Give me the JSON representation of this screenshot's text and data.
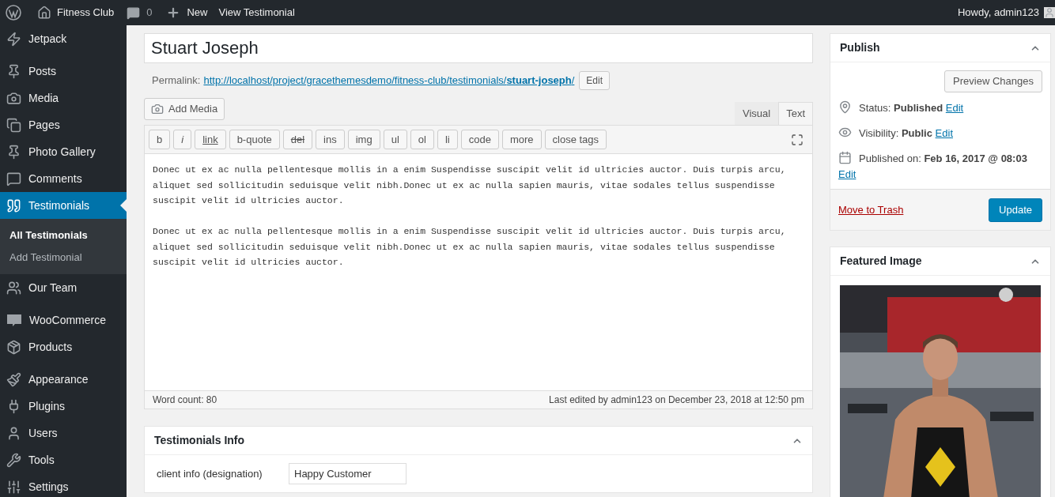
{
  "admin_bar": {
    "site_name": "Fitness Club",
    "comments_count": "0",
    "new_label": "New",
    "view_label": "View Testimonial",
    "greeting": "Howdy, admin123"
  },
  "sidebar": {
    "groups": [
      [
        {
          "label": "Jetpack",
          "selected": false
        }
      ],
      [
        {
          "label": "Posts",
          "selected": false
        },
        {
          "label": "Media",
          "selected": false
        },
        {
          "label": "Pages",
          "selected": false
        },
        {
          "label": "Photo Gallery",
          "selected": false
        },
        {
          "label": "Comments",
          "selected": false
        },
        {
          "label": "Testimonials",
          "selected": true,
          "children": [
            {
              "label": "All Testimonials",
              "selected": true
            },
            {
              "label": "Add Testimonial",
              "selected": false
            }
          ]
        },
        {
          "label": "Our Team",
          "selected": false
        }
      ],
      [
        {
          "label": "WooCommerce",
          "selected": false
        },
        {
          "label": "Products",
          "selected": false
        }
      ],
      [
        {
          "label": "Appearance",
          "selected": false
        },
        {
          "label": "Plugins",
          "selected": false
        },
        {
          "label": "Users",
          "selected": false
        },
        {
          "label": "Tools",
          "selected": false
        },
        {
          "label": "Settings",
          "selected": false
        }
      ]
    ]
  },
  "editor": {
    "title": "Stuart Joseph",
    "permalink_label": "Permalink:",
    "permalink_base": "http://localhost/project/gracethemesdemo/fitness-club/testimonials/",
    "permalink_slug": "stuart-joseph",
    "permalink_end": "/",
    "permalink_edit": "Edit",
    "add_media": "Add Media",
    "tabs": [
      {
        "label": "Visual",
        "selected": false
      },
      {
        "label": "Text",
        "selected": true
      }
    ],
    "quicktags": [
      "b",
      "i",
      "link",
      "b-quote",
      "del",
      "ins",
      "img",
      "ul",
      "ol",
      "li",
      "code",
      "more",
      "close tags"
    ],
    "paragraphs": [
      "Donec ut ex ac nulla pellentesque mollis in a enim Suspendisse suscipit velit id ultricies auctor. Duis turpis arcu, aliquet sed sollicitudin seduisque velit nibh.Donec ut ex ac nulla sapien mauris, vitae sodales tellus suspendisse suscipit velit id ultricies auctor.",
      "Donec ut ex ac nulla pellentesque mollis in a enim Suspendisse suscipit velit id ultricies auctor. Duis turpis arcu, aliquet sed sollicitudin seduisque velit nibh.Donec ut ex ac nulla sapien mauris, vitae sodales tellus suspendisse suscipit velit id ultricies auctor."
    ],
    "word_count": "Word count: 80",
    "last_edited": "Last edited by admin123 on December 23, 2018 at 12:50 pm"
  },
  "testimonials_info": {
    "title": "Testimonials Info",
    "fields": [
      {
        "label": "client info (designation)",
        "value": "Happy Customer"
      }
    ]
  },
  "publish": {
    "title": "Publish",
    "preview": "Preview Changes",
    "rows": [
      {
        "kind": "status",
        "text": "Status: **Published**",
        "edit": "Edit"
      },
      {
        "kind": "visibility",
        "text": "Visibility: **Public**",
        "edit": "Edit"
      },
      {
        "kind": "date",
        "text": "Published on: **Feb 16, 2017 @ 08:03**",
        "edit": "Edit"
      }
    ],
    "trash": "Move to Trash",
    "update": "Update"
  },
  "featured_image": {
    "title": "Featured Image",
    "kind": "picture"
  }
}
